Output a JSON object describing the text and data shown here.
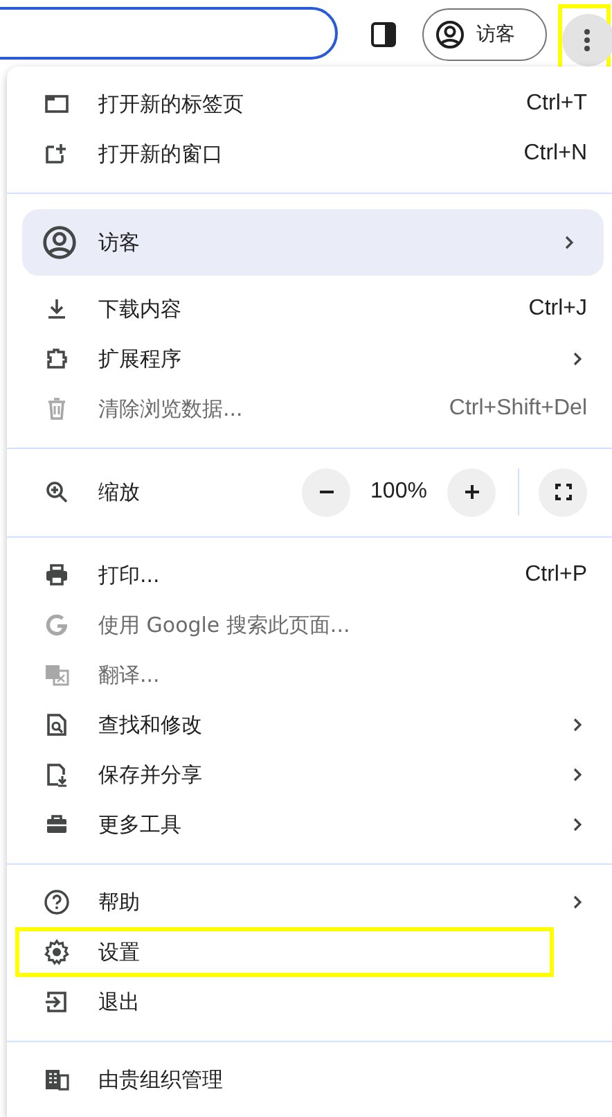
{
  "toolbar": {
    "profile_chip": {
      "label": "访客"
    },
    "menu_button": {
      "highlighted": true
    }
  },
  "menu": {
    "sections": [
      {
        "items": [
          {
            "kind": "item",
            "label": "打开新的标签页",
            "shortcut": "Ctrl+T",
            "disabled": false,
            "submenu": false,
            "highlighted": false
          },
          {
            "kind": "item",
            "label": "打开新的窗口",
            "shortcut": "Ctrl+N",
            "disabled": false,
            "submenu": false,
            "highlighted": false
          }
        ]
      },
      {
        "items": [
          {
            "kind": "profile",
            "label": "访客",
            "disabled": false,
            "submenu": true,
            "highlighted": false
          },
          {
            "kind": "item",
            "label": "下载内容",
            "shortcut": "Ctrl+J",
            "disabled": false,
            "submenu": false,
            "highlighted": false
          },
          {
            "kind": "item",
            "label": "扩展程序",
            "disabled": false,
            "submenu": true,
            "highlighted": false
          },
          {
            "kind": "item",
            "label": "清除浏览数据...",
            "shortcut": "Ctrl+Shift+Del",
            "disabled": true,
            "submenu": false,
            "highlighted": false
          }
        ]
      },
      {
        "items": [
          {
            "kind": "zoom",
            "label": "缩放",
            "value": "100%"
          }
        ]
      },
      {
        "items": [
          {
            "kind": "item",
            "label": "打印...",
            "shortcut": "Ctrl+P",
            "disabled": false,
            "submenu": false,
            "highlighted": false
          },
          {
            "kind": "item",
            "label": "使用 Google 搜索此页面...",
            "disabled": true,
            "submenu": false,
            "highlighted": false
          },
          {
            "kind": "item",
            "label": "翻译...",
            "disabled": true,
            "submenu": false,
            "highlighted": false
          },
          {
            "kind": "item",
            "label": "查找和修改",
            "disabled": false,
            "submenu": true,
            "highlighted": false
          },
          {
            "kind": "item",
            "label": "保存并分享",
            "disabled": false,
            "submenu": true,
            "highlighted": false
          },
          {
            "kind": "item",
            "label": "更多工具",
            "disabled": false,
            "submenu": true,
            "highlighted": false
          }
        ]
      },
      {
        "items": [
          {
            "kind": "item",
            "label": "帮助",
            "disabled": false,
            "submenu": true,
            "highlighted": false
          },
          {
            "kind": "item",
            "label": "设置",
            "disabled": false,
            "submenu": false,
            "highlighted": true
          },
          {
            "kind": "item",
            "label": "退出",
            "disabled": false,
            "submenu": false,
            "highlighted": false
          }
        ]
      },
      {
        "items": [
          {
            "kind": "item",
            "label": "由贵组织管理",
            "disabled": false,
            "submenu": false,
            "highlighted": false
          }
        ]
      }
    ]
  }
}
